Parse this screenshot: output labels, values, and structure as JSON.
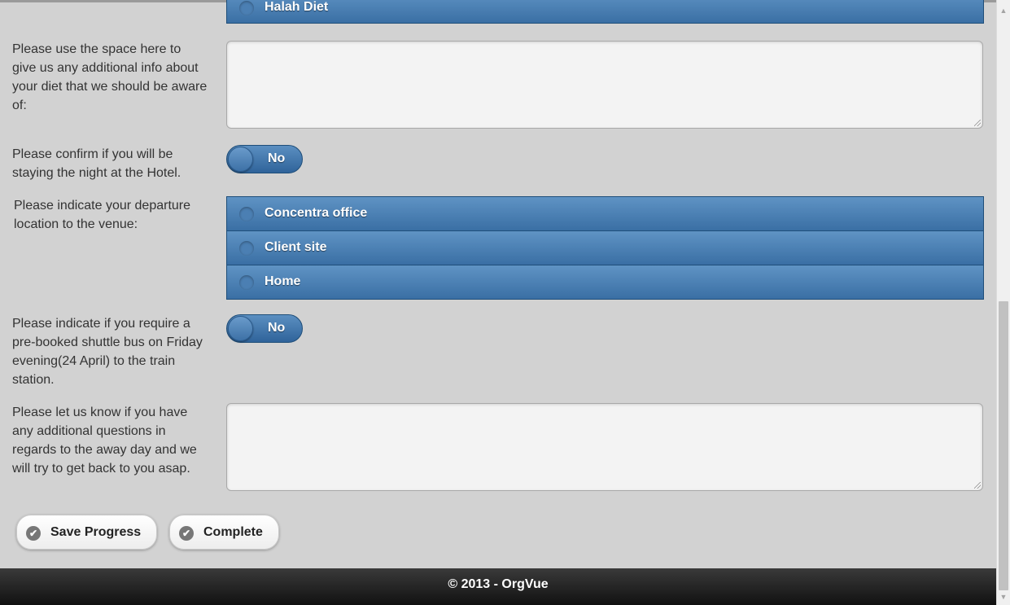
{
  "diet": {
    "partial_option": "Halah Diet",
    "additional_info_label": "Please use the space here to give us any additional info about your diet that we should be aware of:",
    "additional_info_value": ""
  },
  "hotel": {
    "label": "Please confirm if you will be staying the night at the Hotel.",
    "toggle_value": "No"
  },
  "departure": {
    "label": "Please indicate your departure location to the venue:",
    "options": [
      "Concentra office",
      "Client site",
      "Home"
    ]
  },
  "shuttle": {
    "label": "Please indicate if you require a pre-booked shuttle bus on Friday evening(24 April) to the train station.",
    "toggle_value": "No"
  },
  "questions": {
    "label": "Please let us know if you have any additional questions in regards to the away day and we will try to get back to you asap.",
    "value": ""
  },
  "actions": {
    "save_label": "Save Progress",
    "complete_label": "Complete",
    "check_icon": "✔"
  },
  "footer": {
    "copyright": "© 2013 - OrgVue"
  },
  "colors": {
    "accent_blue": "#3a6fa4",
    "footer_bg": "#1a1a1a"
  }
}
